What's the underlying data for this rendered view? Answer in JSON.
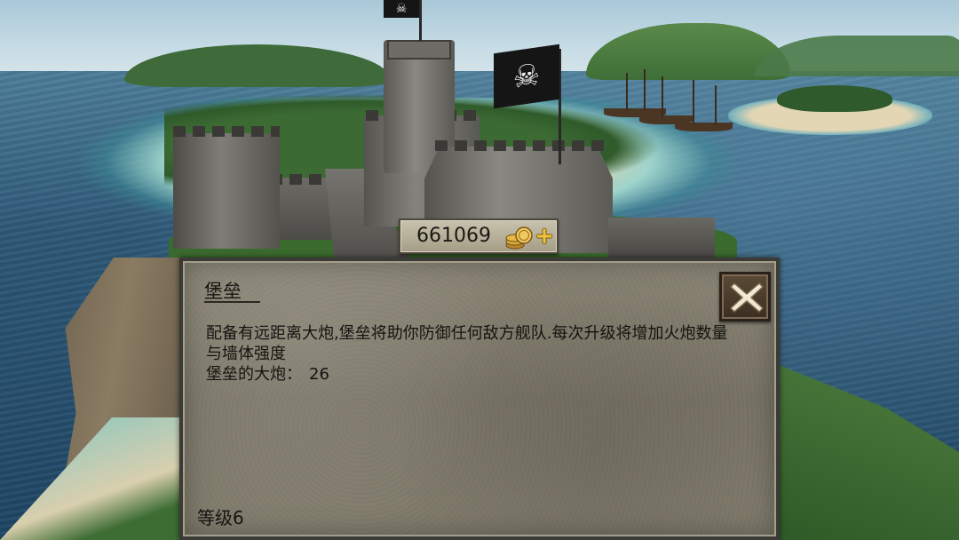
{
  "hud": {
    "gold_amount": "661069",
    "coin_icon": "gold-coins-icon",
    "add_icon": "plus-icon"
  },
  "info_panel": {
    "title": "堡垒",
    "description": "配备有远距离大炮,堡垒将助你防御任何敌方舰队.每次升级将增加火炮数量与墙体强度",
    "cannon_label": "堡垒的大炮：",
    "cannon_value": "26",
    "level_label": "等级6",
    "close_icon": "close-icon"
  },
  "colors": {
    "panel_background": "#847f70",
    "panel_border": "#3c3a35",
    "gold_plus": "#f0c23a",
    "close_button": "#4b3c2c"
  }
}
